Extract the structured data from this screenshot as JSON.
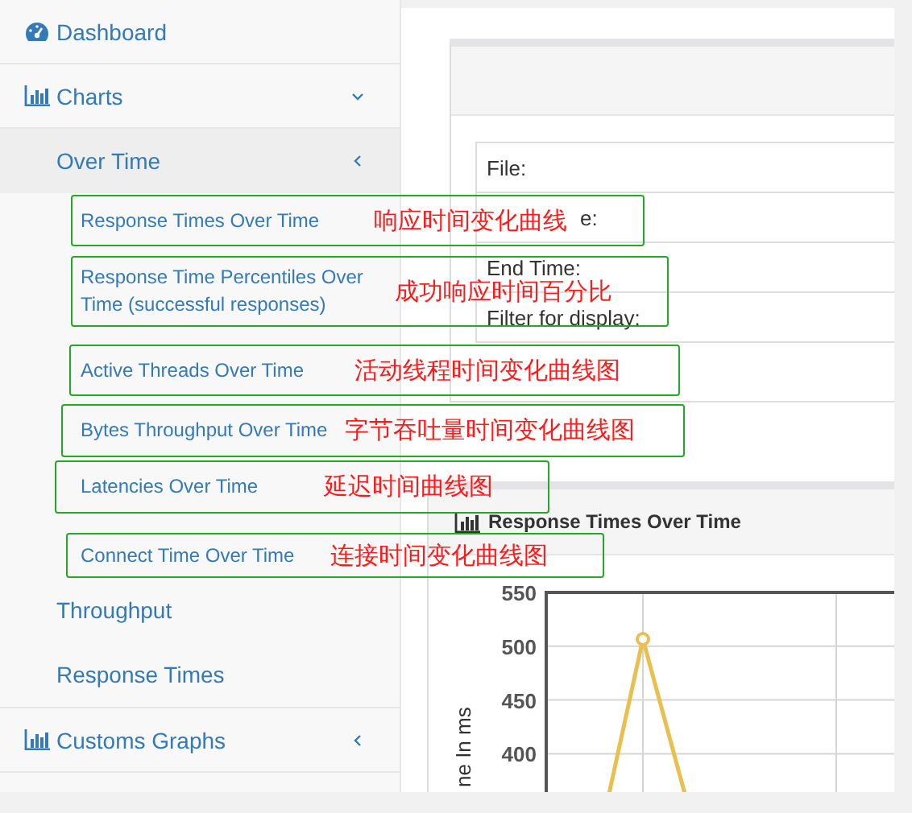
{
  "sidebar": {
    "items": [
      {
        "label": "Dashboard"
      },
      {
        "label": "Charts",
        "expanded": true,
        "children": [
          {
            "label": "Over Time",
            "expanded": true,
            "children": [
              {
                "label": "Response Times Over Time",
                "annotation": "响应时间变化曲线"
              },
              {
                "label": "Response Time Percentiles Over Time (successful responses)",
                "annotation": "成功响应时间百分比"
              },
              {
                "label": "Active Threads Over Time",
                "annotation": "活动线程时间变化曲线图"
              },
              {
                "label": "Bytes Throughput Over Time",
                "annotation": "字节吞吐量时间变化曲线图"
              },
              {
                "label": "Latencies Over Time",
                "annotation": "延迟时间曲线图"
              },
              {
                "label": "Connect Time Over Time",
                "annotation": "连接时间变化曲线图"
              }
            ]
          },
          {
            "label": "Throughput"
          },
          {
            "label": "Response Times"
          }
        ]
      },
      {
        "label": "Customs Graphs",
        "expanded": false
      }
    ]
  },
  "info_panel": {
    "rows": [
      "File:",
      "e:",
      "End Time:",
      "Filter for display:"
    ]
  },
  "chart_panel": {
    "title": "Response Times Over Time",
    "y_ticks": [
      "550",
      "500",
      "450",
      "400"
    ],
    "y_title": "ne In ms"
  }
}
